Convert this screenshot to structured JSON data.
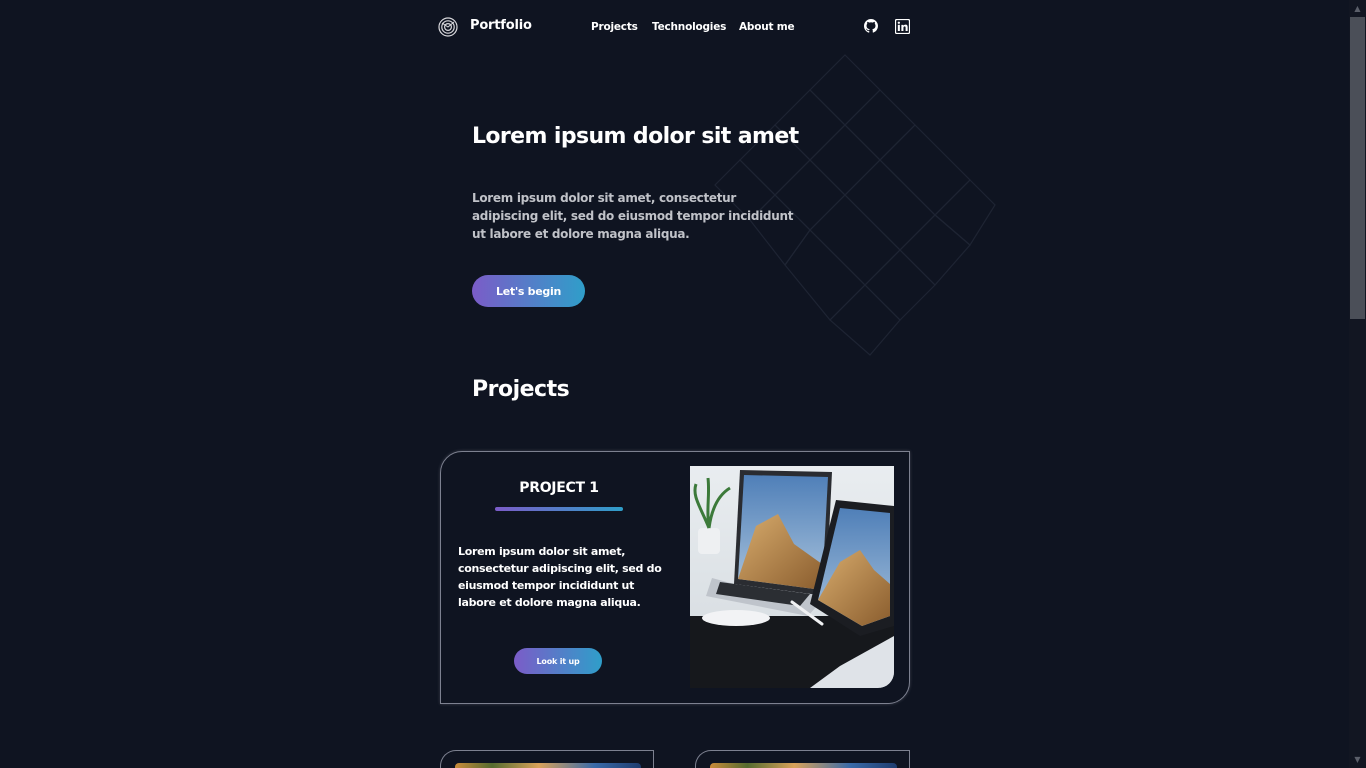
{
  "header": {
    "brand": "Portfolio",
    "nav": [
      {
        "label": "Projects"
      },
      {
        "label": "Technologies"
      },
      {
        "label": "About me"
      }
    ],
    "social_icons": [
      "github-icon",
      "linkedin-icon"
    ]
  },
  "hero": {
    "title": "Lorem ipsum dolor sit amet",
    "text": "Lorem ipsum dolor sit amet, consectetur adipiscing elit, sed do eiusmod tempor incididunt ut labore et dolore magna aliqua.",
    "cta_label": "Let's begin"
  },
  "projects_section": {
    "title": "Projects",
    "items": [
      {
        "title": "PROJECT 1",
        "description": "Lorem ipsum dolor sit amet, consectetur adipiscing elit, sed do eiusmod tempor incididunt ut labore et dolore magna aliqua.",
        "button_label": "Look it up",
        "image": "laptop-tablet-desk-photo"
      }
    ]
  },
  "colors": {
    "background": "#0f1421",
    "accent_start": "#7b5cc8",
    "accent_end": "#2f9ec9",
    "card_border": "#7d8190"
  }
}
